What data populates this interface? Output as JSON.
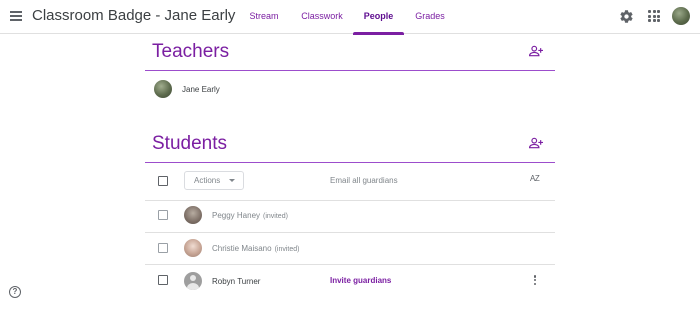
{
  "header": {
    "title": "Classroom Badge - Jane Early",
    "tabs": [
      {
        "label": "Stream",
        "active": false
      },
      {
        "label": "Classwork",
        "active": false
      },
      {
        "label": "People",
        "active": true
      },
      {
        "label": "Grades",
        "active": false
      }
    ],
    "icons": [
      "menu-icon",
      "gear-icon",
      "apps-grid-icon",
      "account-avatar"
    ]
  },
  "teachers": {
    "title": "Teachers",
    "add_icon": "person-add-icon",
    "list": [
      {
        "name": "Jane Early"
      }
    ]
  },
  "students": {
    "title": "Students",
    "add_icon": "person-add-icon",
    "toolbar": {
      "actions_label": "Actions",
      "email_guardians_label": "Email all guardians",
      "sort_label": "AZ"
    },
    "list": [
      {
        "name": "Peggy Haney",
        "status": "(invited)"
      },
      {
        "name": "Christie Maisano",
        "status": "(invited)"
      },
      {
        "name": "Robyn Turner",
        "guardian_link": "Invite guardians"
      }
    ]
  },
  "footer": {
    "help_label": "?"
  },
  "colors": {
    "accent": "#7b1fa2",
    "divider": "#9c4dcc",
    "text": "#3c4043",
    "muted": "#80868b"
  }
}
